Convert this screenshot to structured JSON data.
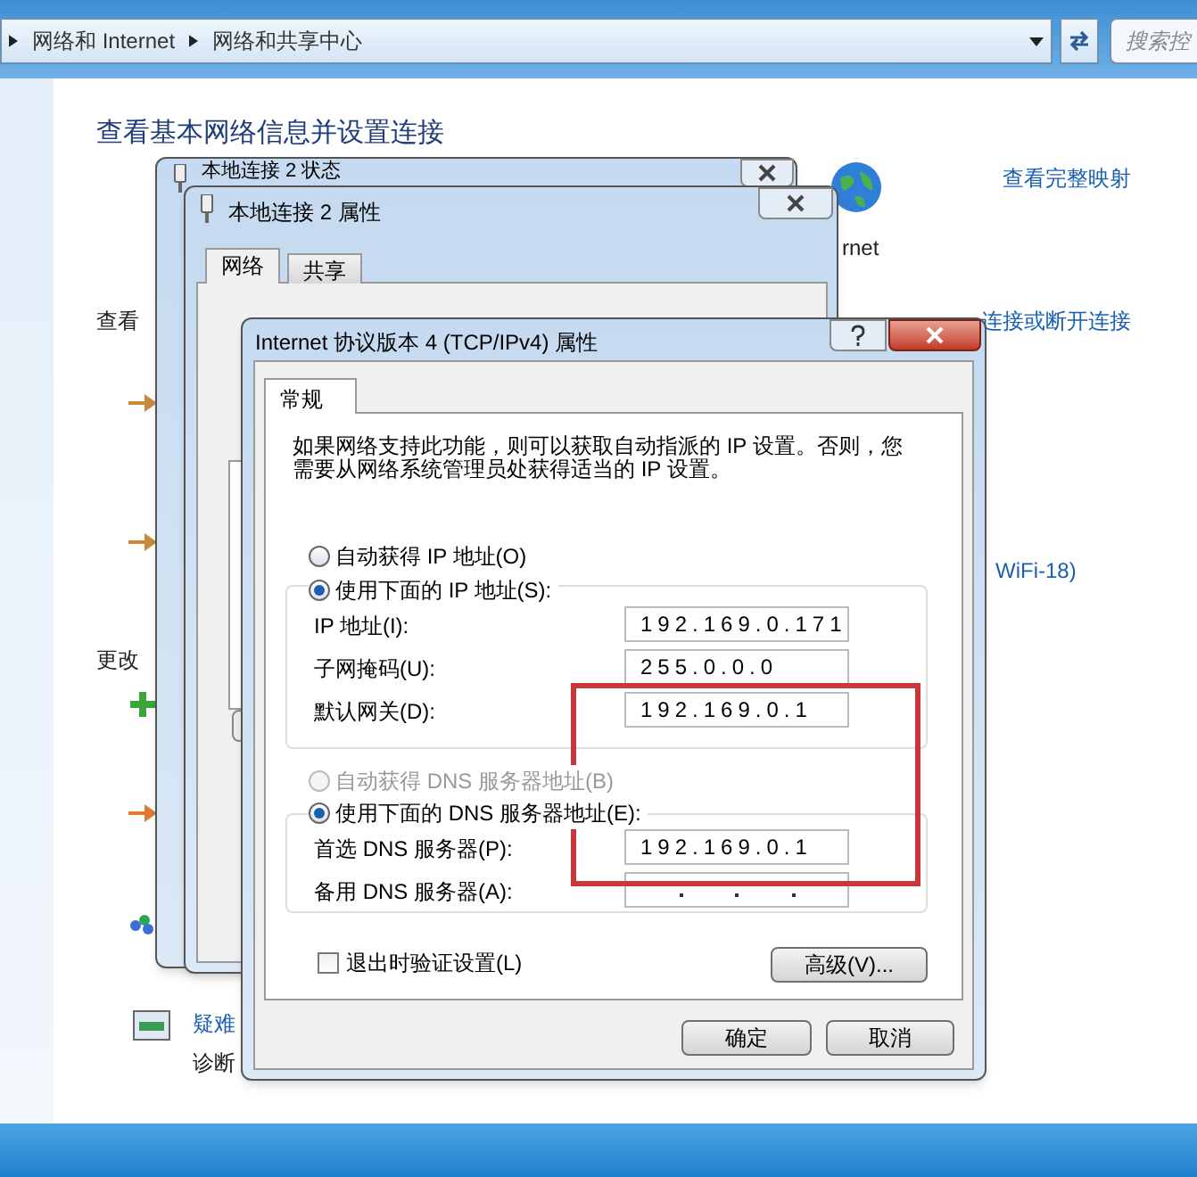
{
  "address_bar": {
    "breadcrumbs": [
      "网络和 Internet",
      "网络和共享中心"
    ],
    "search": {
      "placeholder": "搜索控"
    }
  },
  "page": {
    "title": "查看基本网络信息并设置连接",
    "view_full_map": "查看完整映射",
    "internet_label": "rnet",
    "view_active": "查看",
    "connect_link": "连接或断开连接",
    "wifi_link": "WiFi-18)",
    "change_settings": "更改",
    "troubleshoot_link": "疑难",
    "diagnose": "诊断"
  },
  "status_window": {
    "title": "本地连接 2 状态"
  },
  "properties_window": {
    "title": "本地连接 2 属性",
    "tabs": [
      {
        "label": "网络",
        "selected": true
      },
      {
        "label": "共享",
        "selected": false
      }
    ]
  },
  "ipv4_dialog": {
    "title": "Internet 协议版本 4 (TCP/IPv4) 属性",
    "tabs": [
      {
        "label": "常规",
        "selected": true
      }
    ],
    "description": "如果网络支持此功能，则可以获取自动指派的 IP 设置。否则，您需要从网络系统管理员处获得适当的 IP 设置。",
    "ip_mode": [
      {
        "label": "自动获得 IP 地址(O)",
        "selected": false,
        "disabled": false
      },
      {
        "label": "使用下面的 IP 地址(S):",
        "selected": true,
        "disabled": false
      }
    ],
    "ip_fields": [
      {
        "label": "IP 地址(I):",
        "value": "192.169.0.171"
      },
      {
        "label": "子网掩码(U):",
        "value": "255.0.0.0"
      },
      {
        "label": "默认网关(D):",
        "value": "192.169.0.1"
      }
    ],
    "dns_mode": [
      {
        "label": "自动获得 DNS 服务器地址(B)",
        "selected": false,
        "disabled": true
      },
      {
        "label": "使用下面的 DNS 服务器地址(E):",
        "selected": true,
        "disabled": false
      }
    ],
    "dns_fields": [
      {
        "label": "首选 DNS 服务器(P):",
        "value": "192.169.0.1"
      },
      {
        "label": "备用 DNS 服务器(A):"
      }
    ],
    "validate": {
      "label": "退出时验证设置(L)",
      "checked": false
    },
    "advanced_button": "高级(V)...",
    "ok_button": "确定",
    "cancel_button": "取消"
  }
}
